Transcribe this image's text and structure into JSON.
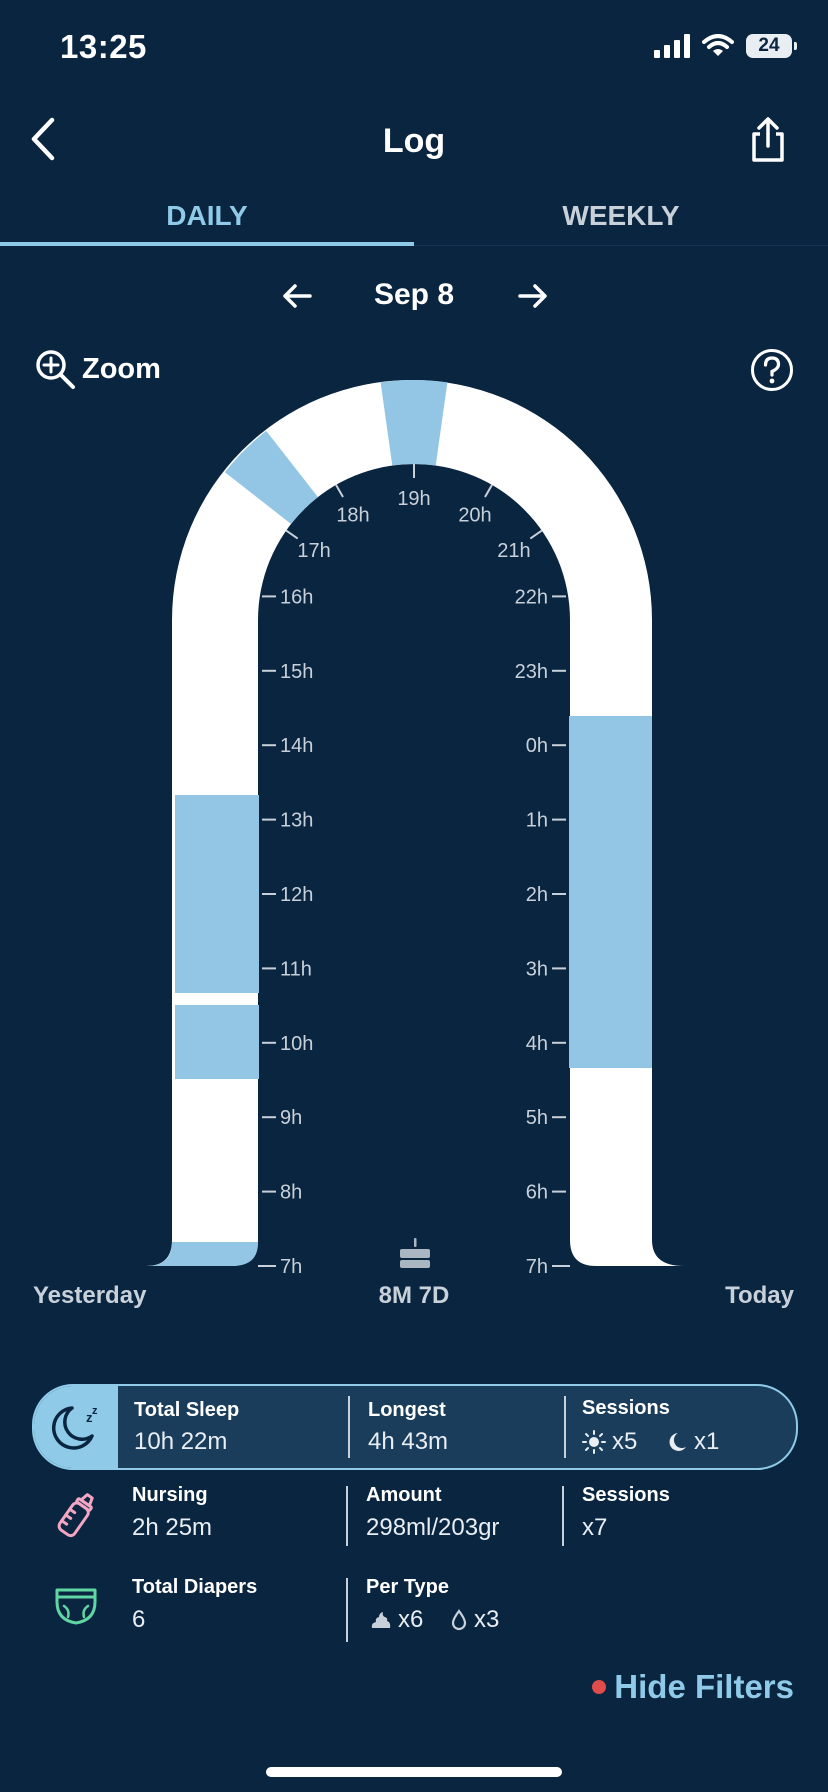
{
  "status": {
    "time": "13:25",
    "battery": "24"
  },
  "header": {
    "title": "Log"
  },
  "tabs": [
    {
      "label": "DAILY",
      "active": true
    },
    {
      "label": "WEEKLY",
      "active": false
    }
  ],
  "date_nav": {
    "label": "Sep 8"
  },
  "zoom": {
    "label": "Zoom"
  },
  "chart": {
    "left_hour_labels": [
      "7h",
      "8h",
      "9h",
      "10h",
      "11h",
      "12h",
      "13h",
      "14h",
      "15h",
      "16h"
    ],
    "arch_hour_labels": [
      "17h",
      "18h",
      "19h",
      "20h",
      "21h"
    ],
    "right_hour_labels": [
      "22h",
      "23h",
      "0h",
      "1h",
      "2h",
      "3h",
      "4h",
      "5h",
      "6h",
      "7h"
    ],
    "left_caption": "Yesterday",
    "center_caption": "8M 7D",
    "right_caption": "Today",
    "track_color": "#ffffff",
    "sleep_color": "#92c6e4"
  },
  "stats": {
    "sleep": {
      "total_label": "Total Sleep",
      "total_value": "10h 22m",
      "longest_label": "Longest",
      "longest_value": "4h 43m",
      "sessions_label": "Sessions",
      "day_sessions": "x5",
      "night_sessions": "x1"
    },
    "nursing": {
      "label": "Nursing",
      "value": "2h 25m",
      "amount_label": "Amount",
      "amount_value": "298ml/203gr",
      "sessions_label": "Sessions",
      "sessions_value": "x7"
    },
    "diapers": {
      "label": "Total Diapers",
      "value": "6",
      "per_type_label": "Per Type",
      "poop": "x6",
      "wet": "x3"
    }
  },
  "filters": {
    "label": "Hide Filters"
  }
}
